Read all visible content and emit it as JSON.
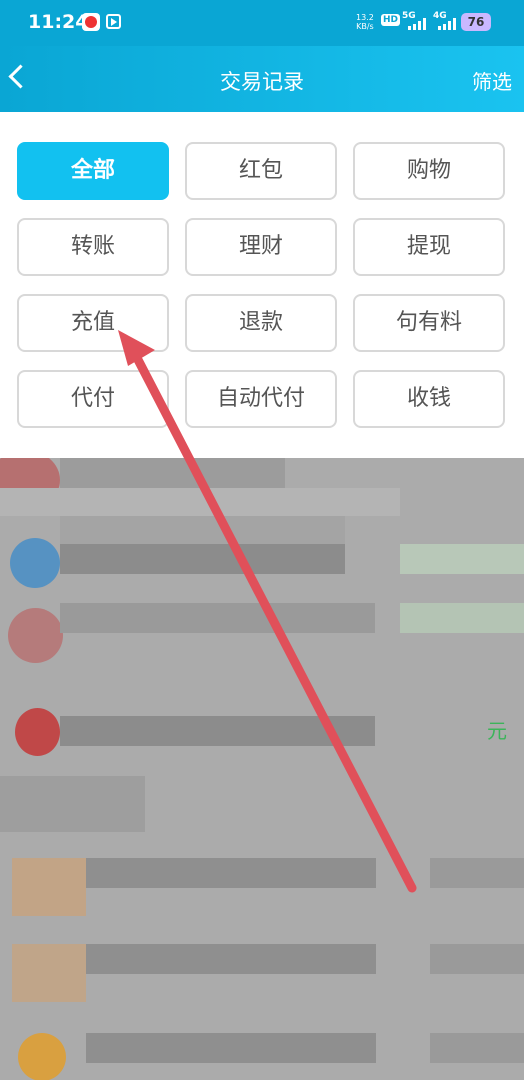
{
  "status_bar": {
    "time": "11:24",
    "net_speed": "13.2",
    "net_speed_unit": "KB/s",
    "hd_label": "HD",
    "sim1_label": "5G",
    "sim2_label": "4G",
    "battery": "76"
  },
  "nav": {
    "title": "交易记录",
    "filter_label": "筛选"
  },
  "filters": [
    {
      "label": "全部",
      "active": true
    },
    {
      "label": "红包",
      "active": false
    },
    {
      "label": "购物",
      "active": false
    },
    {
      "label": "转账",
      "active": false
    },
    {
      "label": "理财",
      "active": false
    },
    {
      "label": "提现",
      "active": false
    },
    {
      "label": "充值",
      "active": false
    },
    {
      "label": "退款",
      "active": false
    },
    {
      "label": "句有料",
      "active": false
    },
    {
      "label": "代付",
      "active": false
    },
    {
      "label": "自动代付",
      "active": false
    },
    {
      "label": "收钱",
      "active": false
    }
  ],
  "list": {
    "amount_unit": "元"
  },
  "colors": {
    "accent": "#12c1f0",
    "nav_bar": "#0aa6d4",
    "annotation_arrow": "#e0505a"
  }
}
